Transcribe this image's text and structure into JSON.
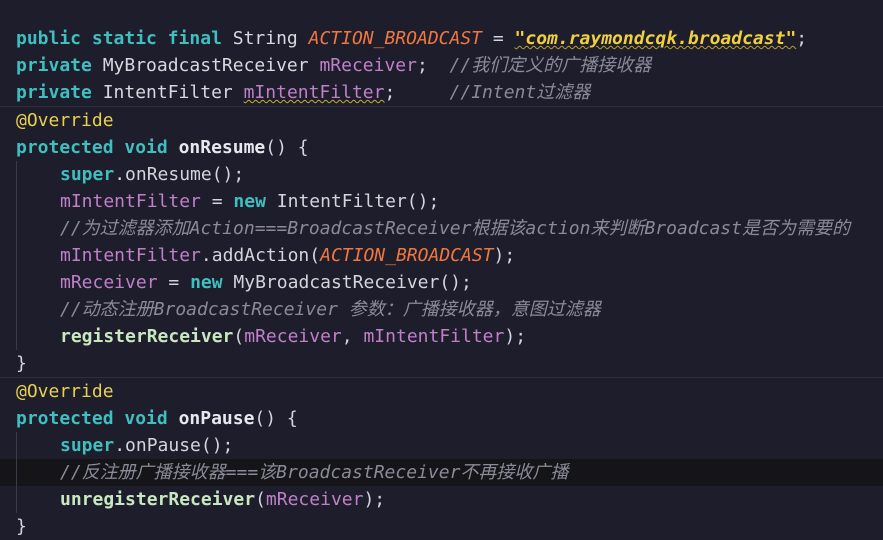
{
  "colors": {
    "background": "#1d1d2b",
    "keyword": "#3fbfbf",
    "constant": "#f07840",
    "string": "#f0d040",
    "field": "#c080c8",
    "comment": "#8a8a98",
    "annotation": "#e8d050"
  },
  "lines": [
    {
      "indent": 0,
      "tokens": [
        {
          "t": "public static final ",
          "c": "kw"
        },
        {
          "t": "String ",
          "c": "type"
        },
        {
          "t": "ACTION_BROADCAST",
          "c": "const"
        },
        {
          "t": " = ",
          "c": "plain"
        },
        {
          "t": "\"com.raymondcqk.broadcast\"",
          "c": "str"
        },
        {
          "t": ";",
          "c": "plain"
        }
      ]
    },
    {
      "indent": 0,
      "tokens": [
        {
          "t": "private ",
          "c": "kw"
        },
        {
          "t": "MyBroadcastReceiver ",
          "c": "type"
        },
        {
          "t": "mReceiver",
          "c": "field"
        },
        {
          "t": ";  ",
          "c": "plain"
        },
        {
          "t": "//我们定义的广播接收器",
          "c": "cmt"
        }
      ]
    },
    {
      "indent": 0,
      "tokens": [
        {
          "t": "private ",
          "c": "kw"
        },
        {
          "t": "IntentFilter ",
          "c": "type"
        },
        {
          "t": "mIntentFilter",
          "c": "field warn"
        },
        {
          "t": ";     ",
          "c": "plain"
        },
        {
          "t": "//Intent过滤器",
          "c": "cmt"
        }
      ]
    },
    {
      "indent": 0,
      "sep": true,
      "tokens": [
        {
          "t": "@Override",
          "c": "ann"
        }
      ]
    },
    {
      "indent": 0,
      "tokens": [
        {
          "t": "protected void ",
          "c": "kw"
        },
        {
          "t": "onResume",
          "c": "fn"
        },
        {
          "t": "() {",
          "c": "plain"
        }
      ]
    },
    {
      "indent": 1,
      "tokens": [
        {
          "t": "super",
          "c": "sup"
        },
        {
          "t": ".onResume();",
          "c": "plain"
        }
      ]
    },
    {
      "indent": 1,
      "tokens": [
        {
          "t": "mIntentFilter",
          "c": "field"
        },
        {
          "t": " = ",
          "c": "plain"
        },
        {
          "t": "new ",
          "c": "kw"
        },
        {
          "t": "IntentFilter();",
          "c": "plain"
        }
      ]
    },
    {
      "indent": 1,
      "tokens": [
        {
          "t": "//为过滤器添加Action===BroadcastReceiver根据该action来判断Broadcast是否为需要的",
          "c": "cmt"
        }
      ]
    },
    {
      "indent": 1,
      "tokens": [
        {
          "t": "mIntentFilter",
          "c": "field"
        },
        {
          "t": ".addAction(",
          "c": "plain"
        },
        {
          "t": "ACTION_BROADCAST",
          "c": "const"
        },
        {
          "t": ");",
          "c": "plain"
        }
      ]
    },
    {
      "indent": 1,
      "tokens": [
        {
          "t": "mReceiver",
          "c": "field"
        },
        {
          "t": " = ",
          "c": "plain"
        },
        {
          "t": "new ",
          "c": "kw"
        },
        {
          "t": "MyBroadcastReceiver();",
          "c": "plain"
        }
      ]
    },
    {
      "indent": 1,
      "tokens": [
        {
          "t": "//动态注册BroadcastReceiver 参数：广播接收器，意图过滤器",
          "c": "cmt"
        }
      ]
    },
    {
      "indent": 1,
      "tokens": [
        {
          "t": "registerReceiver",
          "c": "call"
        },
        {
          "t": "(",
          "c": "plain"
        },
        {
          "t": "mReceiver",
          "c": "field"
        },
        {
          "t": ", ",
          "c": "plain"
        },
        {
          "t": "mIntentFilter",
          "c": "field"
        },
        {
          "t": ");",
          "c": "plain"
        }
      ]
    },
    {
      "indent": 0,
      "tokens": [
        {
          "t": "}",
          "c": "plain"
        }
      ]
    },
    {
      "indent": 0,
      "sep": true,
      "tokens": [
        {
          "t": "@Override",
          "c": "ann"
        }
      ]
    },
    {
      "indent": 0,
      "tokens": [
        {
          "t": "protected void ",
          "c": "kw"
        },
        {
          "t": "onPause",
          "c": "fn"
        },
        {
          "t": "() {",
          "c": "plain"
        }
      ]
    },
    {
      "indent": 1,
      "tokens": [
        {
          "t": "super",
          "c": "sup"
        },
        {
          "t": ".onPause();",
          "c": "plain"
        }
      ]
    },
    {
      "indent": 1,
      "current": true,
      "tokens": [
        {
          "t": "//反注册广播接收器===该BroadcastReceiver不再接收广播",
          "c": "cmt"
        }
      ]
    },
    {
      "indent": 1,
      "tokens": [
        {
          "t": "unregisterReceiver",
          "c": "call"
        },
        {
          "t": "(",
          "c": "plain"
        },
        {
          "t": "mReceiver",
          "c": "field"
        },
        {
          "t": ");",
          "c": "plain"
        }
      ]
    },
    {
      "indent": 0,
      "tokens": [
        {
          "t": "}",
          "c": "plain"
        }
      ]
    }
  ]
}
